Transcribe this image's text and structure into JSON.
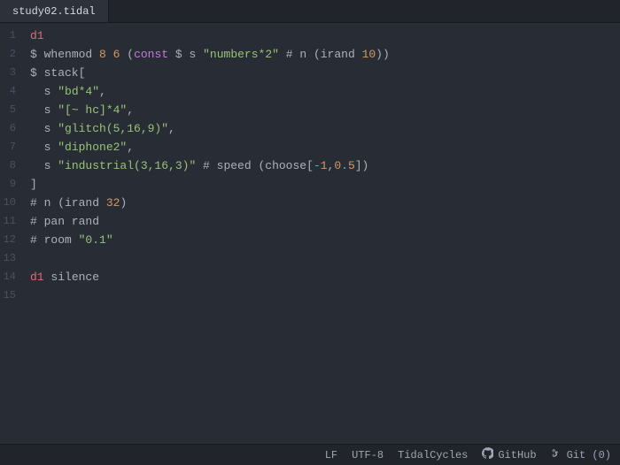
{
  "tab": {
    "title": "study02.tidal"
  },
  "gutter": {
    "count": 15
  },
  "code": {
    "current_line_index": 11,
    "lines": [
      [
        {
          "t": "d1",
          "c": "t-red"
        }
      ],
      [
        {
          "t": "$ ",
          "c": "t-fg"
        },
        {
          "t": "whenmod ",
          "c": "t-fg"
        },
        {
          "t": "8",
          "c": "t-orange"
        },
        {
          "t": " ",
          "c": "t-fg"
        },
        {
          "t": "6",
          "c": "t-orange"
        },
        {
          "t": " (",
          "c": "t-fg"
        },
        {
          "t": "const",
          "c": "t-purple"
        },
        {
          "t": " $ s ",
          "c": "t-fg"
        },
        {
          "t": "\"numbers*2\"",
          "c": "t-green"
        },
        {
          "t": " # n (irand ",
          "c": "t-fg"
        },
        {
          "t": "10",
          "c": "t-orange"
        },
        {
          "t": "))",
          "c": "t-fg"
        }
      ],
      [
        {
          "t": "$ stack[",
          "c": "t-fg"
        }
      ],
      [
        {
          "t": "  s ",
          "c": "t-fg"
        },
        {
          "t": "\"bd*4\"",
          "c": "t-green"
        },
        {
          "t": ",",
          "c": "t-fg"
        }
      ],
      [
        {
          "t": "  s ",
          "c": "t-fg"
        },
        {
          "t": "\"[~ hc]*4\"",
          "c": "t-green"
        },
        {
          "t": ",",
          "c": "t-fg"
        }
      ],
      [
        {
          "t": "  s ",
          "c": "t-fg"
        },
        {
          "t": "\"glitch(5,16,9)\"",
          "c": "t-green"
        },
        {
          "t": ",",
          "c": "t-fg"
        }
      ],
      [
        {
          "t": "  s ",
          "c": "t-fg"
        },
        {
          "t": "\"diphone2\"",
          "c": "t-green"
        },
        {
          "t": ",",
          "c": "t-fg"
        }
      ],
      [
        {
          "t": "  s ",
          "c": "t-fg"
        },
        {
          "t": "\"industrial(3,16,3)\"",
          "c": "t-green"
        },
        {
          "t": " # speed (choose[",
          "c": "t-fg"
        },
        {
          "t": "-",
          "c": "t-op"
        },
        {
          "t": "1",
          "c": "t-orange"
        },
        {
          "t": ",",
          "c": "t-fg"
        },
        {
          "t": "0",
          "c": "t-orange"
        },
        {
          "t": ".",
          "c": "t-op"
        },
        {
          "t": "5",
          "c": "t-orange"
        },
        {
          "t": "])",
          "c": "t-fg"
        }
      ],
      [
        {
          "t": "]",
          "c": "t-fg"
        }
      ],
      [
        {
          "t": "# n (irand ",
          "c": "t-fg"
        },
        {
          "t": "32",
          "c": "t-orange"
        },
        {
          "t": ")",
          "c": "t-fg"
        }
      ],
      [
        {
          "t": "# pan rand",
          "c": "t-fg"
        }
      ],
      [
        {
          "t": "# room ",
          "c": "t-fg"
        },
        {
          "t": "\"0.1\"",
          "c": "t-green"
        }
      ],
      [],
      [
        {
          "t": "d1",
          "c": "t-red"
        },
        {
          "t": " silence",
          "c": "t-fg"
        }
      ],
      []
    ]
  },
  "status": {
    "eol": "LF",
    "encoding": "UTF-8",
    "language": "TidalCycles",
    "github": "GitHub",
    "git": "Git (0)"
  }
}
